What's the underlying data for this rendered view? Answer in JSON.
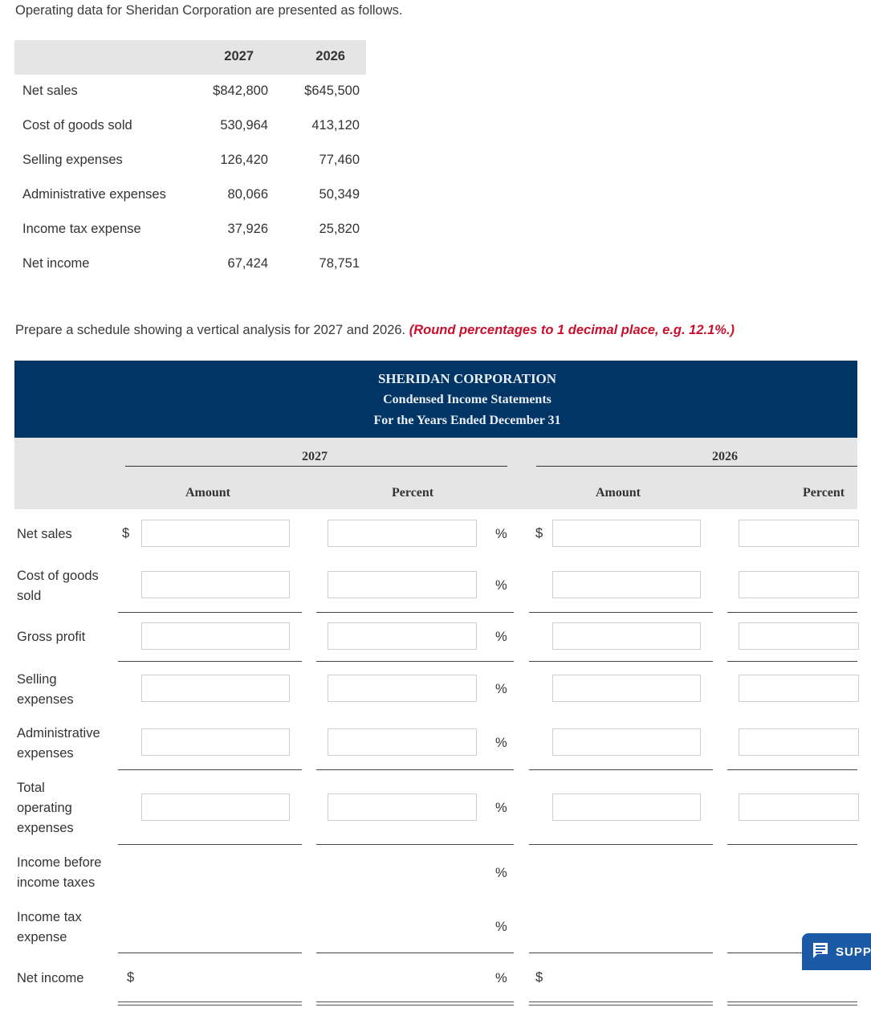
{
  "intro": "Operating data for Sheridan Corporation are presented as follows.",
  "data_table": {
    "years": [
      "2027",
      "2026"
    ],
    "rows": [
      {
        "label": "Net sales",
        "v2027": "$842,800",
        "v2026": "$645,500"
      },
      {
        "label": "Cost of goods sold",
        "v2027": "530,964",
        "v2026": "413,120"
      },
      {
        "label": "Selling expenses",
        "v2027": "126,420",
        "v2026": "77,460"
      },
      {
        "label": "Administrative expenses",
        "v2027": "80,066",
        "v2026": "50,349"
      },
      {
        "label": "Income tax expense",
        "v2027": "37,926",
        "v2026": "25,820"
      },
      {
        "label": "Net income",
        "v2027": "67,424",
        "v2026": "78,751"
      }
    ]
  },
  "instruction": {
    "text": "Prepare a schedule showing a vertical analysis for 2027 and 2026.",
    "note": "(Round percentages to 1 decimal place, e.g. 12.1%.)"
  },
  "statement": {
    "company": "SHERIDAN CORPORATION",
    "title": "Condensed Income Statements",
    "period": "For the Years Ended December 31",
    "year1": "2027",
    "year2": "2026",
    "amount_label": "Amount",
    "percent_label": "Percent",
    "currency_symbol": "$",
    "percent_symbol": "%",
    "rows": [
      {
        "label": "Net sales",
        "amount_2027": "",
        "percent_2027": "",
        "amount_2026": "",
        "percent_2026": ""
      },
      {
        "label": "Cost of goods sold",
        "amount_2027": "",
        "percent_2027": "",
        "amount_2026": "",
        "percent_2026": ""
      },
      {
        "label": "Gross profit",
        "amount_2027": "",
        "percent_2027": "",
        "amount_2026": "",
        "percent_2026": ""
      },
      {
        "label": "Selling expenses",
        "amount_2027": "",
        "percent_2027": "",
        "amount_2026": "",
        "percent_2026": ""
      },
      {
        "label": "Administrative expenses",
        "amount_2027": "",
        "percent_2027": "",
        "amount_2026": "",
        "percent_2026": ""
      },
      {
        "label": "Total operating expenses",
        "amount_2027": "",
        "percent_2027": "",
        "amount_2026": "",
        "percent_2026": ""
      },
      {
        "label": "Income before income taxes"
      },
      {
        "label": "Income tax expense"
      },
      {
        "label": "Net income"
      }
    ]
  },
  "support_button": {
    "label": "SUPP",
    "icon": "chat-icon"
  }
}
